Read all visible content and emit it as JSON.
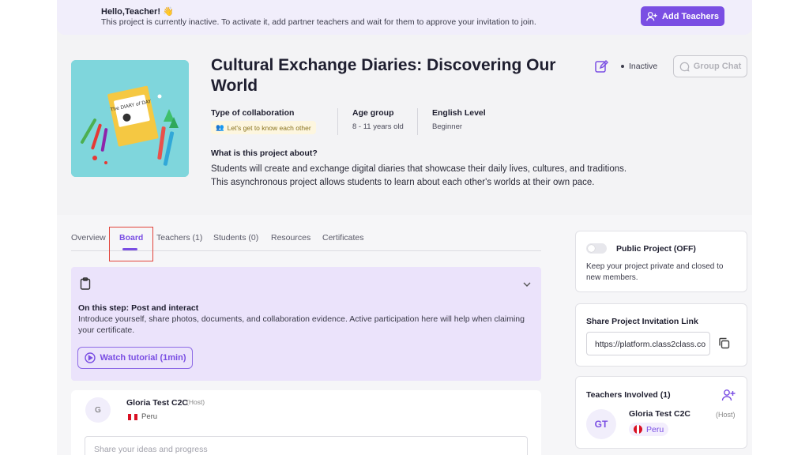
{
  "banner": {
    "greeting": "Hello,Teacher! 👋",
    "message": "This project is currently inactive. To activate it, add partner teachers and wait for them to approve your invitation to join.",
    "add_teachers_label": "Add Teachers"
  },
  "project": {
    "title": "Cultural Exchange Diaries: Discovering Our World",
    "status": "Inactive",
    "group_chat_label": "Group Chat",
    "cover_book_title": "The DIARY of DAY",
    "type_label": "Type of collaboration",
    "type_value": "Let's get to know each other",
    "age_label": "Age group",
    "age_value": "8 - 11 years old",
    "english_label": "English Level",
    "english_value": "Beginner",
    "about_label": "What is this project about?",
    "about_text": "Students will create and exchange digital diaries that showcase their daily lives, cultures, and traditions. This asynchronous project allows students to learn about each other's worlds at their own pace."
  },
  "tabs": [
    "Overview",
    "Board",
    "Teachers (1)",
    "Students (0)",
    "Resources",
    "Certificates"
  ],
  "step": {
    "title": "On this step: Post and interact",
    "text": "Introduce yourself, share photos, documents, and collaboration evidence. Active participation here will help when claiming your certificate.",
    "tutorial_label": "Watch tutorial (1min)"
  },
  "post": {
    "avatar": "G",
    "name": "Gloria Test C2C",
    "host": "(Host)",
    "country": "Peru",
    "placeholder": "Share your ideas and progress"
  },
  "public_project": {
    "title": "Public Project (OFF)",
    "text": "Keep your project private and closed to new members."
  },
  "invitation": {
    "title": "Share Project Invitation Link",
    "link": "https://platform.class2class.co"
  },
  "teachers": {
    "title": "Teachers Involved (1)",
    "initials": "GT",
    "name": "Gloria Test C2C",
    "host": "(Host)",
    "country": "Peru"
  },
  "colors": {
    "accent": "#7a4ee3",
    "highlight": "#e2433a",
    "flag_red": "#d91023"
  }
}
